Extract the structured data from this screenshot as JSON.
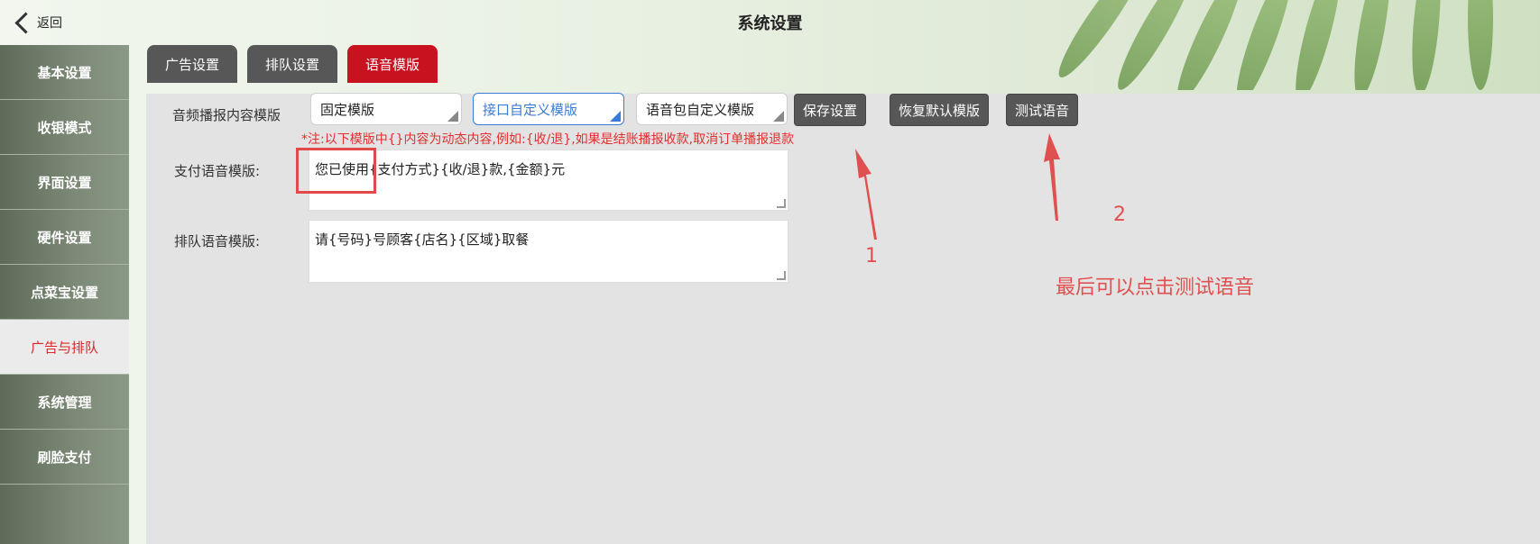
{
  "header": {
    "back_label": "返回",
    "title": "系统设置"
  },
  "sidebar": {
    "items": [
      {
        "label": "基本设置",
        "active": false
      },
      {
        "label": "收银模式",
        "active": false
      },
      {
        "label": "界面设置",
        "active": false
      },
      {
        "label": "硬件设置",
        "active": false
      },
      {
        "label": "点菜宝设置",
        "active": false
      },
      {
        "label": "广告与排队",
        "active": true
      },
      {
        "label": "系统管理",
        "active": false
      },
      {
        "label": "刷脸支付",
        "active": false
      }
    ]
  },
  "tabs": [
    {
      "label": "广告设置",
      "active": false
    },
    {
      "label": "排队设置",
      "active": false
    },
    {
      "label": "语音模版",
      "active": true
    }
  ],
  "form": {
    "audio_template_label": "音频播报内容模版",
    "template_options": [
      {
        "label": "固定模版",
        "active": false
      },
      {
        "label": "接口自定义模版",
        "active": true
      },
      {
        "label": "语音包自定义模版",
        "active": false
      }
    ],
    "buttons": {
      "save": "保存设置",
      "restore": "恢复默认模版",
      "test": "测试语音"
    },
    "note": "*注:以下模版中{}内容为动态内容,例如:{收/退},如果是结账播报收款,取消订单播报退款",
    "payment_label": "支付语音模版:",
    "payment_value": "您已使用{支付方式}{收/退}款,{金额}元",
    "queue_label": "排队语音模版:",
    "queue_value": "请{号码}号顾客{店名}{区域}取餐"
  },
  "annotations": {
    "step1": "1",
    "step2": "2",
    "hint": "最后可以点击测试语音"
  },
  "colors": {
    "accent_red": "#c8121f",
    "tab_gray": "#575757",
    "annotation_red": "#e05050"
  }
}
